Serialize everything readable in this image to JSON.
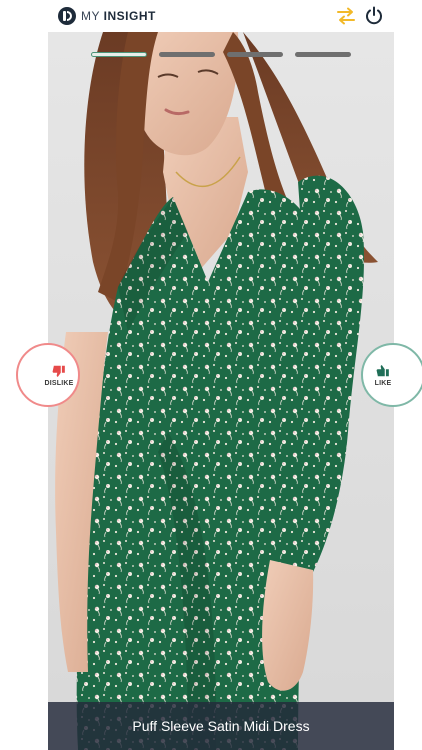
{
  "header": {
    "brand_prefix": "MY",
    "brand_name": "INSIGHT"
  },
  "stage": {
    "progress_total": 4,
    "progress_current": 1,
    "caption": "Puff Sleeve Satin Midi Dress"
  },
  "reactions": {
    "dislike_label": "DISLIKE",
    "like_label": "LIKE"
  },
  "icons": {
    "swap": "swap-arrows-icon",
    "power": "power-icon",
    "dislike": "thumbs-down-icon",
    "like": "thumbs-up-icon"
  },
  "colors": {
    "swap": "#f2b929",
    "dislike": "#e64a4a",
    "like": "#1f6e57",
    "dress": "#1e6b47",
    "caption_bg": "#232a3a"
  }
}
